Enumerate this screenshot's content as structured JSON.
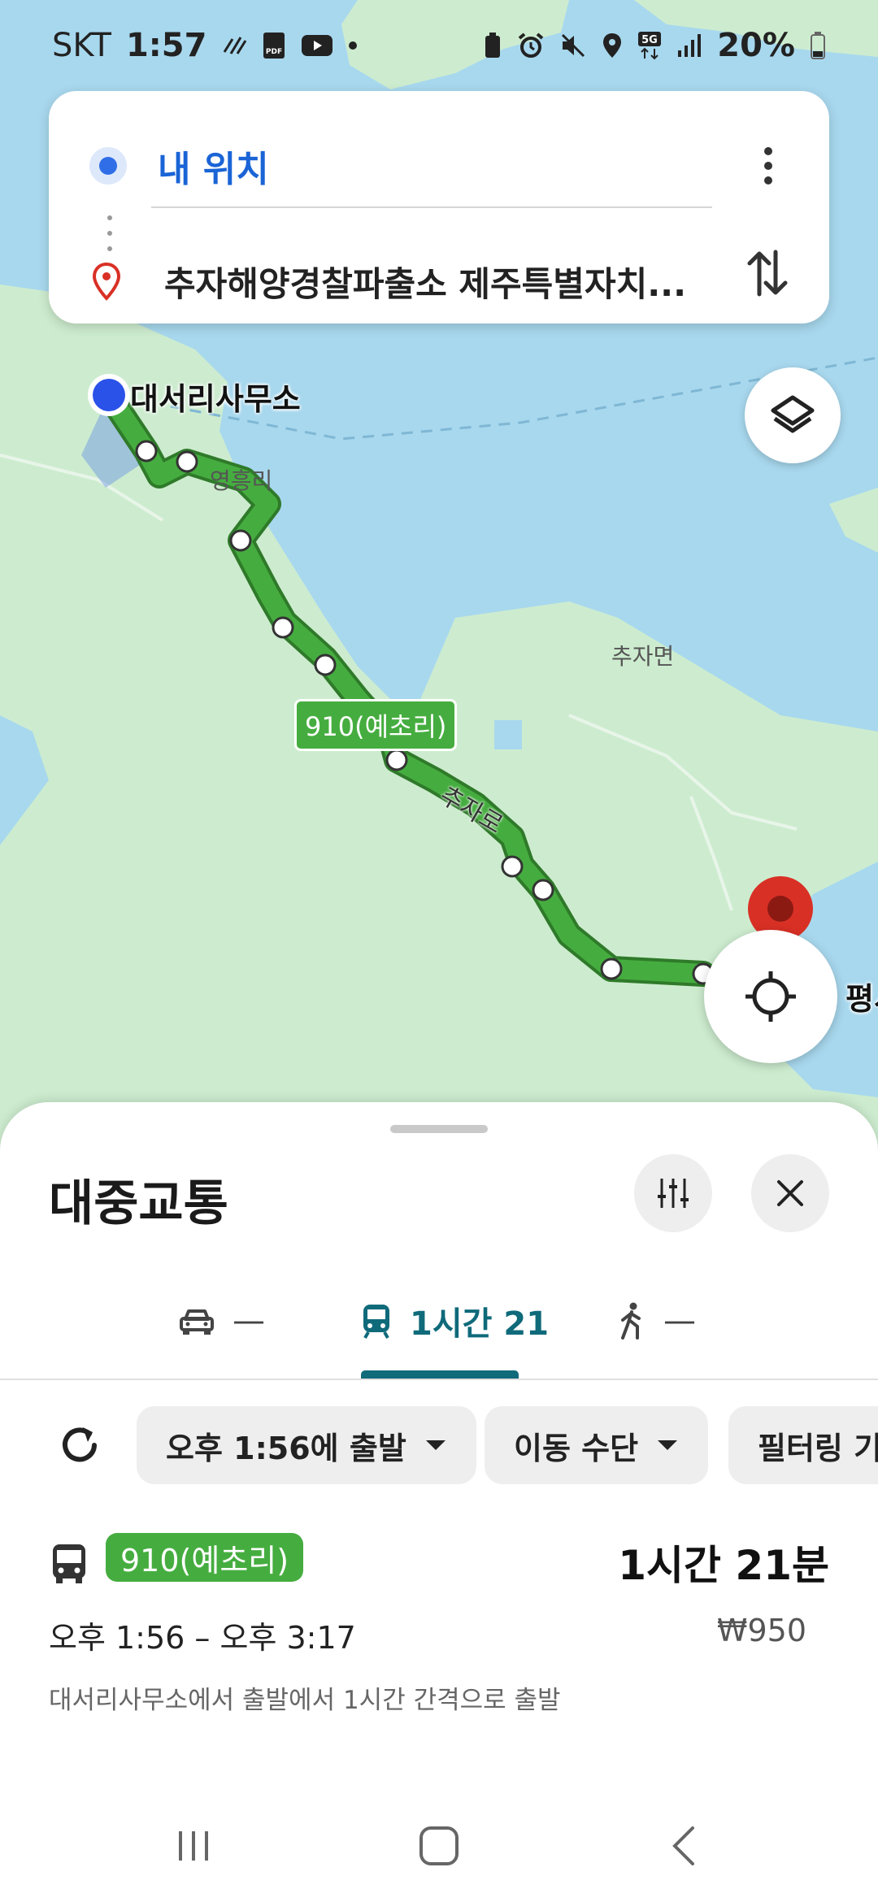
{
  "status_bar": {
    "carrier": "SKT",
    "time": "1:57",
    "battery": "20%",
    "icons_left": [
      "data-stripes-icon",
      "pdf-icon",
      "youtube-icon",
      "dot-icon"
    ],
    "icons_right": [
      "battery-saver-icon",
      "alarm-icon",
      "mute-icon",
      "location-icon",
      "5g-icon",
      "signal-icon",
      "battery-icon"
    ]
  },
  "route_card": {
    "origin": "내 위치",
    "destination": "추자해양경찰파출소 제주특별자치..."
  },
  "map": {
    "origin_pin_label": "대서리사무소",
    "dest_pin_label_partial": "평시",
    "place_labels": [
      "영흥리",
      "추자면",
      "추자로"
    ],
    "route_tag": "910(예초리)",
    "colors": {
      "water": "#a8d8ee",
      "land": "#cdeccf",
      "route": "#45ad3f",
      "origin": "#2a52e8",
      "dest": "#d93025"
    }
  },
  "sheet": {
    "title": "대중교통",
    "tabs": [
      {
        "label": "—",
        "icon": "car-icon",
        "active": false
      },
      {
        "label": "1시간 21",
        "icon": "transit-icon",
        "active": true
      },
      {
        "label": "—",
        "icon": "walk-icon",
        "active": false
      }
    ],
    "chips": {
      "depart": "오후 1:56에 출발",
      "mode": "이동 수단",
      "filter": "필터링 기"
    },
    "result": {
      "route_name": "910(예초리)",
      "duration": "1시간 21분",
      "time_range": "오후 1:56 – 오후 3:17",
      "fare": "₩950",
      "frequency": "대서리사무소에서 출발에서 1시간 간격으로 출발"
    }
  }
}
